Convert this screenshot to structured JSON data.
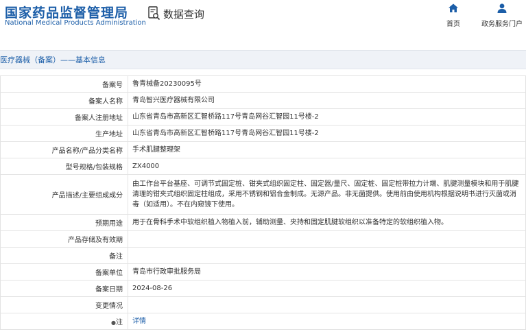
{
  "header": {
    "logo_cn": "国家药品监督管理局",
    "logo_en": "National Medical Products Administration",
    "query_title": "数据查询",
    "nav": [
      {
        "label": "首页",
        "icon": "home-icon"
      },
      {
        "label": "政务服务门户",
        "icon": "user-icon"
      }
    ]
  },
  "section": {
    "title": "医疗器械（备案）——基本信息"
  },
  "rows": [
    {
      "label": "备案号",
      "value": "鲁青械备20230095号"
    },
    {
      "label": "备案人名称",
      "value": "青岛智兴医疗器械有限公司"
    },
    {
      "label": "备案人注册地址",
      "value": "山东省青岛市高新区汇智桥路117号青岛网谷汇智园11号楼-2"
    },
    {
      "label": "生产地址",
      "value": "山东省青岛市高新区汇智桥路117号青岛网谷汇智园11号楼-2"
    },
    {
      "label": "产品名称/产品分类名称",
      "value": "手术肌腱整理架"
    },
    {
      "label": "型号规格/包装规格",
      "value": "ZX4000"
    },
    {
      "label": "产品描述/主要组成成分",
      "value": "由工作台平台基座、可调节式固定桩、钳夹式组织固定柱、固定器/量尺、固定桩、固定桩带拉力计端、肌腱测量模块和用于肌腱清理的钳夹式组织固定柱组成，采用不锈钢和铝合金制成。无源产品。非无菌提供。使用前由使用机构根据说明书进行灭菌或消毒（如适用）。不在内窥镜下使用。"
    },
    {
      "label": "预期用途",
      "value": "用于在骨科手术中软组织植入物植入前，辅助测量、夹持和固定肌腱软组织以准备特定的软组织植入物。"
    },
    {
      "label": "产品存储及有效期",
      "value": ""
    },
    {
      "label": "备注",
      "value": ""
    },
    {
      "label": "备案单位",
      "value": "青岛市行政审批服务局"
    },
    {
      "label": "备案日期",
      "value": "2024-08-26"
    },
    {
      "label": "变更情况",
      "value": ""
    },
    {
      "label": "注",
      "value": "详情"
    }
  ],
  "colors": {
    "brand": "#1c5ea8",
    "bar_bg": "#eff2f7",
    "border": "#e3e3e3"
  }
}
